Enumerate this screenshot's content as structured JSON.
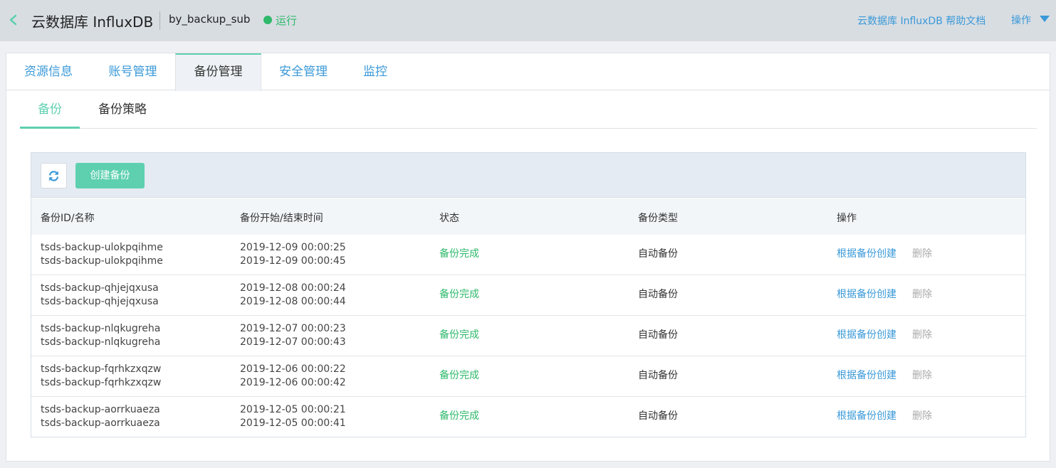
{
  "header": {
    "title": "云数据库 InfluxDB",
    "instance_name": "by_backup_sub",
    "status": "运行",
    "help_link": "云数据库 InfluxDB 帮助文档",
    "ops_label": "操作"
  },
  "tabs": [
    {
      "label": "资源信息"
    },
    {
      "label": "账号管理"
    },
    {
      "label": "备份管理"
    },
    {
      "label": "安全管理"
    },
    {
      "label": "监控"
    }
  ],
  "active_tab": "备份管理",
  "subtabs": [
    {
      "label": "备份"
    },
    {
      "label": "备份策略"
    }
  ],
  "toolbar": {
    "create_label": "创建备份"
  },
  "table": {
    "headers": {
      "id": "备份ID/名称",
      "time": "备份开始/结束时间",
      "status": "状态",
      "type": "备份类型",
      "ops": "操作"
    },
    "rows": [
      {
        "id": "tsds-backup-ulokpqihme",
        "name": "tsds-backup-ulokpqihme",
        "start": "2019-12-09 00:00:25",
        "end": "2019-12-09 00:00:45",
        "status": "备份完成",
        "type": "自动备份",
        "op_create": "根据备份创建",
        "op_delete": "删除"
      },
      {
        "id": "tsds-backup-qhjejqxusa",
        "name": "tsds-backup-qhjejqxusa",
        "start": "2019-12-08 00:00:24",
        "end": "2019-12-08 00:00:44",
        "status": "备份完成",
        "type": "自动备份",
        "op_create": "根据备份创建",
        "op_delete": "删除"
      },
      {
        "id": "tsds-backup-nlqkugreha",
        "name": "tsds-backup-nlqkugreha",
        "start": "2019-12-07 00:00:23",
        "end": "2019-12-07 00:00:43",
        "status": "备份完成",
        "type": "自动备份",
        "op_create": "根据备份创建",
        "op_delete": "删除"
      },
      {
        "id": "tsds-backup-fqrhkzxqzw",
        "name": "tsds-backup-fqrhkzxqzw",
        "start": "2019-12-06 00:00:22",
        "end": "2019-12-06 00:00:42",
        "status": "备份完成",
        "type": "自动备份",
        "op_create": "根据备份创建",
        "op_delete": "删除"
      },
      {
        "id": "tsds-backup-aorrkuaeza",
        "name": "tsds-backup-aorrkuaeza",
        "start": "2019-12-05 00:00:21",
        "end": "2019-12-05 00:00:41",
        "status": "备份完成",
        "type": "自动备份",
        "op_create": "根据备份创建",
        "op_delete": "删除"
      }
    ]
  },
  "colors": {
    "accent": "#5ed0b0",
    "link": "#3a99d8",
    "status_ok": "#2fb96b"
  }
}
